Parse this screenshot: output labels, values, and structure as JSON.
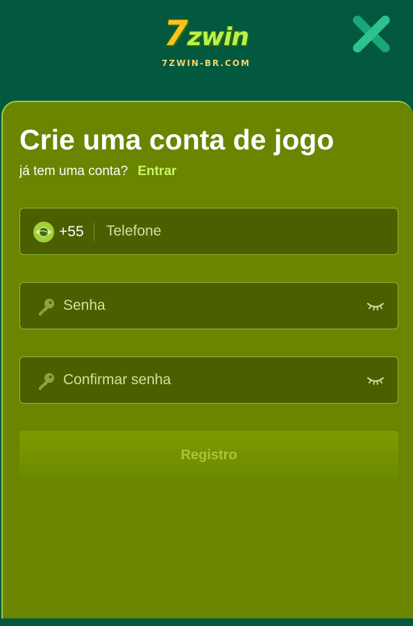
{
  "header": {
    "logo": {
      "seven": "7",
      "word": "zwin",
      "domain": "7ZWIN-BR.COM"
    },
    "close_icon": "close-icon"
  },
  "form": {
    "title": "Crie uma conta de jogo",
    "subtitle": "já tem uma conta?",
    "login_link": "Entrar",
    "phone": {
      "flag_icon": "brazil-flag-icon",
      "country_code": "+55",
      "placeholder": "Telefone",
      "value": ""
    },
    "password": {
      "icon": "key-icon",
      "placeholder": "Senha",
      "value": "",
      "toggle_icon": "eye-closed-icon"
    },
    "confirm_password": {
      "icon": "key-icon",
      "placeholder": "Confirmar senha",
      "value": "",
      "toggle_icon": "eye-closed-icon"
    },
    "submit_label": "Registro"
  },
  "colors": {
    "background": "#03593f",
    "card": "#6a8500",
    "input": "#4b5f00",
    "accent": "#c9f56a",
    "close_icon": "#2ec28e"
  }
}
